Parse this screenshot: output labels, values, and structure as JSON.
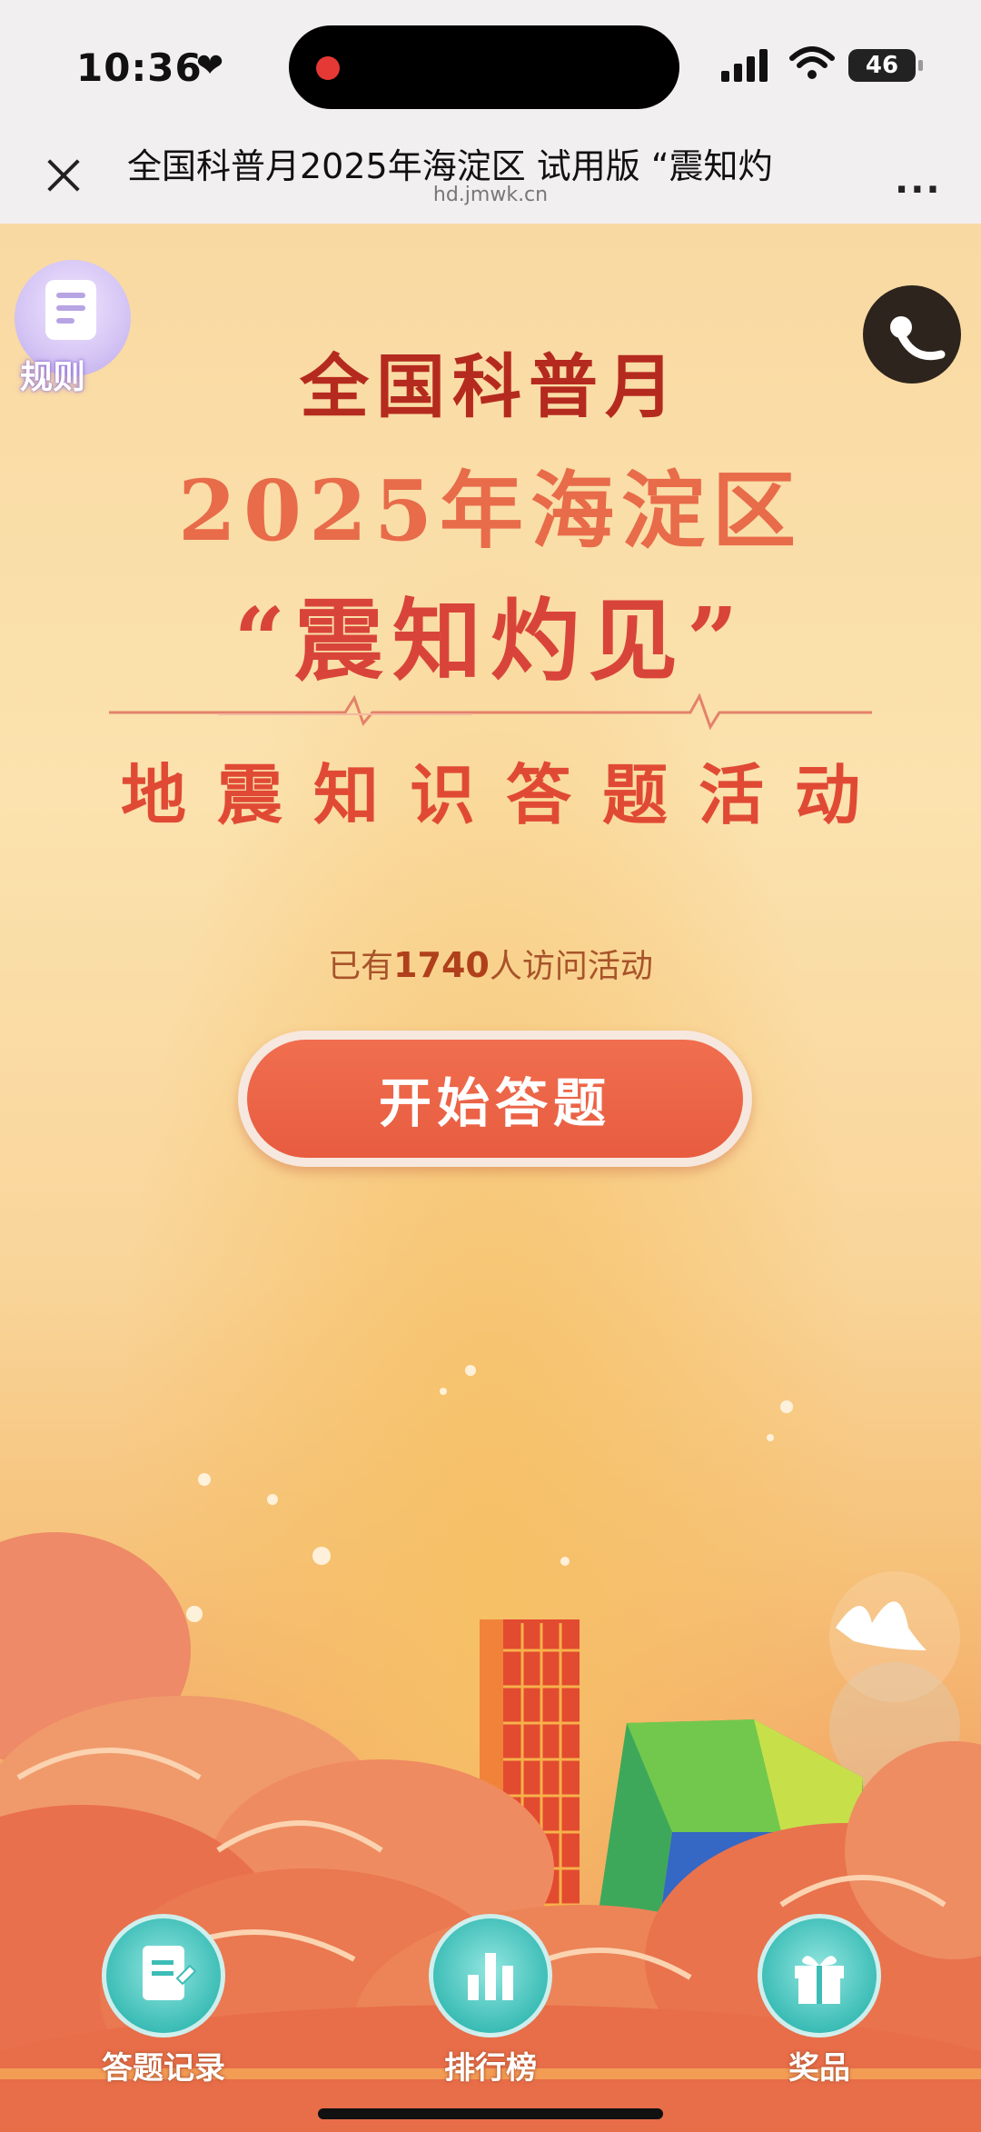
{
  "status_bar": {
    "time": "10:36",
    "battery": "46"
  },
  "browser": {
    "title": "全国科普月2025年海淀区 试用版 “震知灼",
    "url": "hd.jmwk.cn",
    "more": "..."
  },
  "poster": {
    "rules_label": "规则",
    "title_line1": "全国科普月",
    "title_line2": "2025年海淀区",
    "title_line3": "“震知灼见”",
    "title_line4": "地震知识答题活动",
    "visitors_prefix": "已有",
    "visitors_count": "1740",
    "visitors_suffix": "人访问活动",
    "start_button": "开始答题"
  },
  "bottom_nav": [
    {
      "label": "答题记录",
      "icon": "document-edit-icon"
    },
    {
      "label": "排行榜",
      "icon": "bar-chart-icon"
    },
    {
      "label": "奖品",
      "icon": "gift-icon"
    }
  ],
  "colors": {
    "title_dark_red": "#b52a1e",
    "title_coral": "#e86b4a",
    "button_orange": "#e85c40",
    "nav_teal": "#3cbdb6"
  }
}
